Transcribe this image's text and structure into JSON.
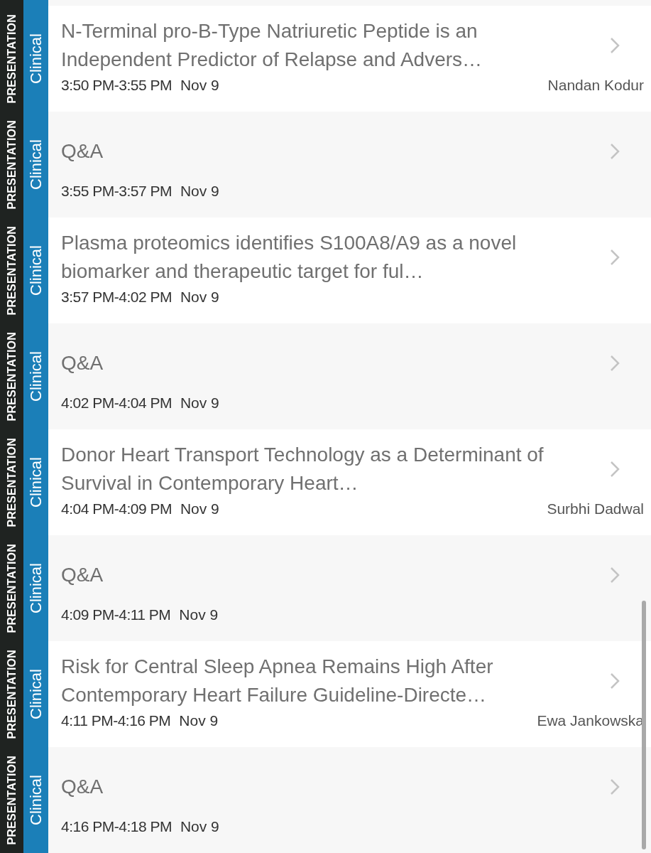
{
  "sessions": [
    {
      "type": "PRESENTATION",
      "track": "Clinical",
      "title": "N-Terminal pro-B-Type Natriuretic Peptide is an Independent Predictor of Relapse and Advers…",
      "time": "3:50 PM-3:55 PM",
      "date": "Nov 9",
      "speaker": "Nandan Kodur"
    },
    {
      "type": "PRESENTATION",
      "track": "Clinical",
      "title": "Q&A",
      "time": "3:55 PM-3:57 PM",
      "date": "Nov 9"
    },
    {
      "type": "PRESENTATION",
      "track": "Clinical",
      "title": "Plasma proteomics identifies S100A8/A9 as a novel biomarker and therapeutic target for ful…",
      "time": "3:57 PM-4:02 PM",
      "date": "Nov 9"
    },
    {
      "type": "PRESENTATION",
      "track": "Clinical",
      "title": "Q&A",
      "time": "4:02 PM-4:04 PM",
      "date": "Nov 9"
    },
    {
      "type": "PRESENTATION",
      "track": "Clinical",
      "title": "Donor Heart Transport Technology as a Determinant of Survival in Contemporary Heart…",
      "time": "4:04 PM-4:09 PM",
      "date": "Nov 9",
      "speaker": "Surbhi Dadwal"
    },
    {
      "type": "PRESENTATION",
      "track": "Clinical",
      "title": "Q&A",
      "time": "4:09 PM-4:11 PM",
      "date": "Nov 9"
    },
    {
      "type": "PRESENTATION",
      "track": "Clinical",
      "title": "Risk for Central Sleep Apnea Remains High After Contemporary Heart Failure Guideline-Directe…",
      "time": "4:11 PM-4:16 PM",
      "date": "Nov 9",
      "speaker": "Ewa Jankowska"
    },
    {
      "type": "PRESENTATION",
      "track": "Clinical",
      "title": "Q&A",
      "time": "4:16 PM-4:18 PM",
      "date": "Nov 9"
    }
  ]
}
